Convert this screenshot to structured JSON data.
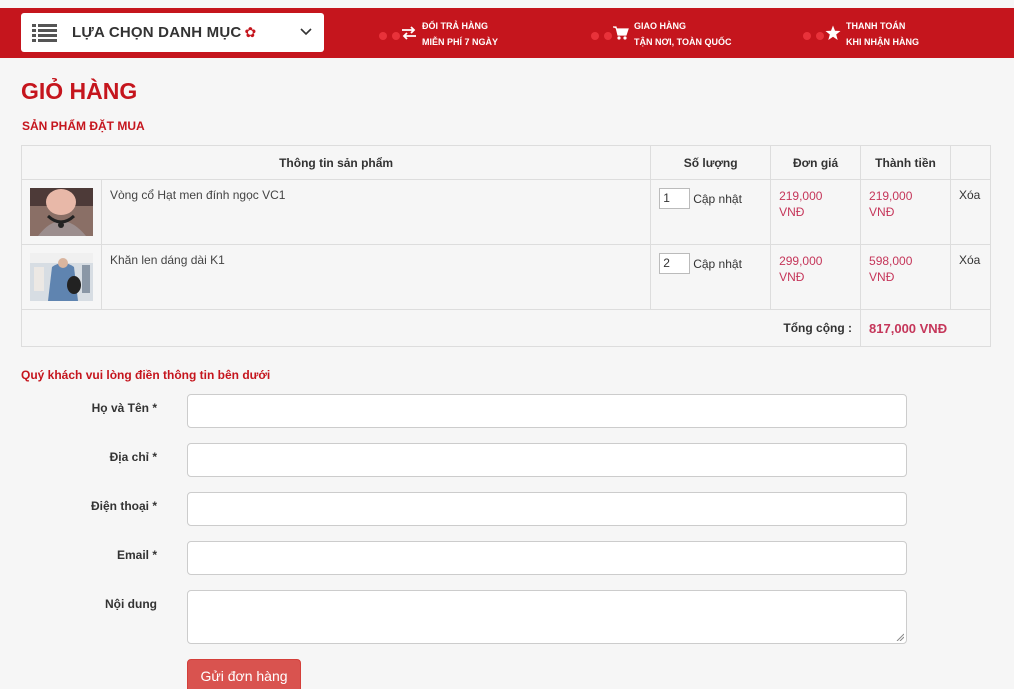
{
  "header": {
    "category_menu_label": "LỰA CHỌN DANH MỤC",
    "features": [
      {
        "icon": "exchange-icon",
        "line1": "ĐỔI TRẢ HÀNG",
        "line2": "MIỄN PHÍ 7 NGÀY"
      },
      {
        "icon": "cart-icon",
        "line1": "GIAO HÀNG",
        "line2": "TẬN NƠI, TOÀN QUỐC"
      },
      {
        "icon": "star-icon",
        "line1": "THANH TOÁN",
        "line2": "KHI NHẬN HÀNG"
      }
    ]
  },
  "page": {
    "title": "GIỎ HÀNG",
    "subtitle": "SẢN PHẨM ĐẶT MUA"
  },
  "cart": {
    "columns": [
      "Thông tin sản phẩm",
      "Số lượng",
      "Đơn giá",
      "Thành tiền",
      ""
    ],
    "items": [
      {
        "name": "Vòng cổ Hạt men đính ngọc VC1",
        "qty": "1",
        "update_label": "Cập nhật",
        "unit_price": "219,000",
        "unit_currency": "VNĐ",
        "total": "219,000",
        "total_currency": "VNĐ",
        "delete_label": "Xóa"
      },
      {
        "name": "Khăn len dáng dài K1",
        "qty": "2",
        "update_label": "Cập nhật",
        "unit_price": "299,000",
        "unit_currency": "VNĐ",
        "total": "598,000",
        "total_currency": "VNĐ",
        "delete_label": "Xóa"
      }
    ],
    "total_label": "Tổng cộng :",
    "total_value": "817,000 VNĐ"
  },
  "form": {
    "note": "Quý khách vui lòng điền thông tin bên dưới",
    "fields": [
      {
        "label": "Họ và Tên *",
        "value": ""
      },
      {
        "label": "Địa chỉ *",
        "value": ""
      },
      {
        "label": "Điện thoại *",
        "value": ""
      },
      {
        "label": "Email *",
        "value": ""
      },
      {
        "label": "Nội dung",
        "value": ""
      }
    ],
    "submit_label": "Gửi đơn hàng"
  },
  "colors": {
    "brand_red": "#c5151d",
    "price": "#c5365a",
    "button": "#d9534f"
  }
}
